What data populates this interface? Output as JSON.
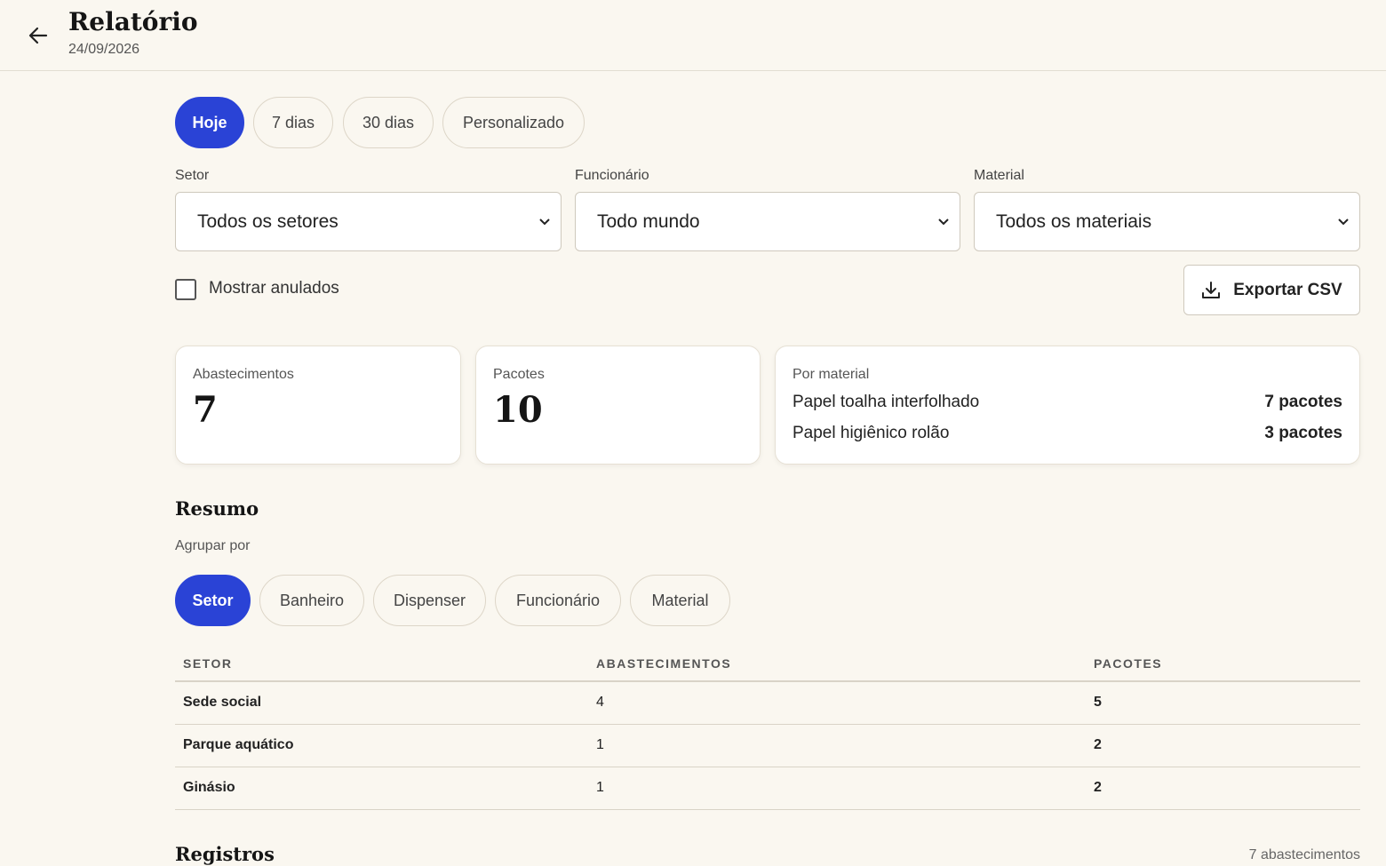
{
  "header": {
    "title": "Relatório",
    "date": "24/09/2026"
  },
  "period_tabs": [
    {
      "label": "Hoje",
      "active": true
    },
    {
      "label": "7 dias",
      "active": false
    },
    {
      "label": "30 dias",
      "active": false
    },
    {
      "label": "Personalizado",
      "active": false
    }
  ],
  "filters": {
    "sector": {
      "label": "Setor",
      "value": "Todos os setores"
    },
    "employee": {
      "label": "Funcionário",
      "value": "Todo mundo"
    },
    "material": {
      "label": "Material",
      "value": "Todos os materiais"
    }
  },
  "show_voided": {
    "label": "Mostrar anulados",
    "checked": false
  },
  "export_label": "Exportar CSV",
  "stats": {
    "refills": {
      "label": "Abastecimentos",
      "value": "7"
    },
    "packages": {
      "label": "Pacotes",
      "value": "10"
    },
    "by_material": {
      "label": "Por material",
      "items": [
        {
          "name": "Papel toalha interfolhado",
          "qty": "7 pacotes"
        },
        {
          "name": "Papel higiênico rolão",
          "qty": "3 pacotes"
        }
      ]
    }
  },
  "summary": {
    "title": "Resumo",
    "group_label": "Agrupar por",
    "group_tabs": [
      {
        "label": "Setor",
        "active": true
      },
      {
        "label": "Banheiro",
        "active": false
      },
      {
        "label": "Dispenser",
        "active": false
      },
      {
        "label": "Funcionário",
        "active": false
      },
      {
        "label": "Material",
        "active": false
      }
    ],
    "columns": [
      "SETOR",
      "ABASTECIMENTOS",
      "PACOTES"
    ],
    "rows": [
      [
        "Sede social",
        "4",
        "5"
      ],
      [
        "Parque aquático",
        "1",
        "2"
      ],
      [
        "Ginásio",
        "1",
        "2"
      ]
    ]
  },
  "records": {
    "title": "Registros",
    "count": "7 abastecimentos"
  },
  "colors": {
    "accent": "#2a43d6",
    "background": "#faf7f0"
  }
}
